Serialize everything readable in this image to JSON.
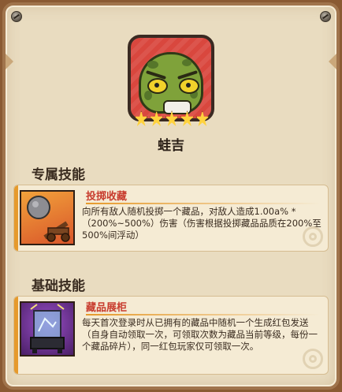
{
  "hero": {
    "name": "蛙吉",
    "star_count": 5,
    "icons": {
      "portrait": "frog-portrait",
      "star": "star-icon"
    }
  },
  "sections": {
    "exclusive": {
      "heading": "专属技能",
      "skill": {
        "name": "投掷收藏",
        "description": "向所有敌人随机投掷一个藏品，对敌人造成1.00a% *（200%~500%）伤害（伤害根据投掷藏品品质在200%至500%间浮动）",
        "icon": "catapult-icon"
      }
    },
    "basic": {
      "heading": "基础技能",
      "skill": {
        "name": "藏品展柜",
        "description": "每天首次登录时从已拥有的藏品中随机一个生成红包发送（自身自动领取一次，可领取次数为藏品当前等级，每份一个藏品碎片），同一红包玩家仅可领取一次。",
        "icon": "display-case-icon"
      }
    }
  },
  "colors": {
    "panel": "#e9dcc0",
    "border": "#a0744c",
    "skill_title": "#c83c2e",
    "accent": "#e69a2c",
    "portrait_bg": "#d9473e",
    "star": "#ffd23d"
  }
}
